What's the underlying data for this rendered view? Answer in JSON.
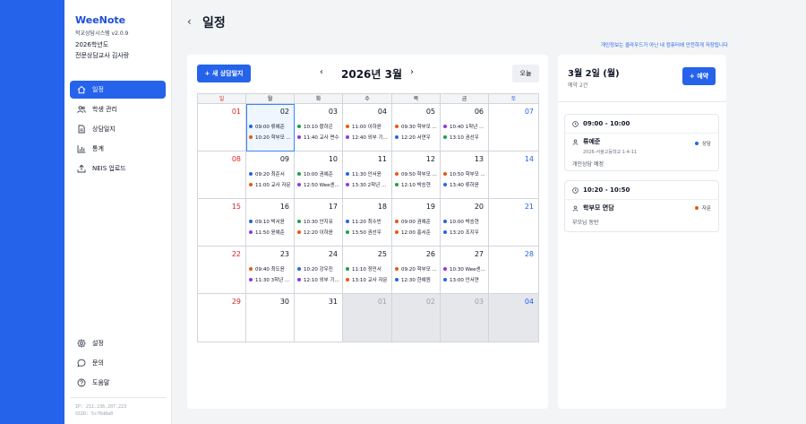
{
  "app": {
    "brand": "WeeNote",
    "version": "학교상담시스템 v2.0.9",
    "school_year": "2026학년도",
    "teacher": "전문상담교사 김사랑"
  },
  "nav": [
    {
      "label": "일정",
      "icon": "calendar-icon",
      "active": true
    },
    {
      "label": "학생 관리",
      "icon": "users-icon",
      "active": false
    },
    {
      "label": "상담일지",
      "icon": "document-icon",
      "active": false
    },
    {
      "label": "통계",
      "icon": "bar-chart-icon",
      "active": false
    },
    {
      "label": "NEIS 업로드",
      "icon": "upload-icon",
      "active": false
    }
  ],
  "nav_bottom": [
    {
      "label": "설정",
      "icon": "gear-icon"
    },
    {
      "label": "문의",
      "icon": "chat-icon"
    },
    {
      "label": "도움말",
      "icon": "help-icon"
    }
  ],
  "ip_info": [
    "IP: 211.236.207.223",
    "SSID: 5c76d8a0"
  ],
  "page": {
    "title": "일정",
    "notice": "개인정보는 클라우드가 아닌 내 컴퓨터에 안전하게 저장됩니다"
  },
  "calendar": {
    "new_button": "+ 새 상담일지",
    "month_title": "2026년 3월",
    "today_button": "오늘",
    "weekdays": [
      "일",
      "월",
      "화",
      "수",
      "목",
      "금",
      "토"
    ],
    "weeks": [
      [
        {
          "day": "01",
          "other": false,
          "events": []
        },
        {
          "day": "02",
          "other": false,
          "selected": true,
          "events": [
            {
              "text": "09:00 류예준",
              "color": "#2563eb"
            },
            {
              "text": "10:20 학부모 ...",
              "color": "#ea580c"
            }
          ]
        },
        {
          "day": "03",
          "other": false,
          "events": [
            {
              "text": "10:10 황하은",
              "color": "#16a34a"
            },
            {
              "text": "11:40 교사 면수",
              "color": "#9333ea"
            }
          ]
        },
        {
          "day": "04",
          "other": false,
          "events": [
            {
              "text": "11:00 이하윤",
              "color": "#ea580c"
            },
            {
              "text": "12:40 외부 기...",
              "color": "#9333ea"
            }
          ]
        },
        {
          "day": "05",
          "other": false,
          "events": [
            {
              "text": "09:30 학부모 ...",
              "color": "#ea580c"
            },
            {
              "text": "12:20 서연우",
              "color": "#2563eb"
            }
          ]
        },
        {
          "day": "06",
          "other": false,
          "events": [
            {
              "text": "10:40 1학년 집...",
              "color": "#9333ea"
            },
            {
              "text": "13:10 권선우",
              "color": "#16a34a"
            }
          ]
        },
        {
          "day": "07",
          "other": false,
          "events": []
        }
      ],
      [
        {
          "day": "08",
          "other": false,
          "events": []
        },
        {
          "day": "09",
          "other": false,
          "events": [
            {
              "text": "09:20 최준서",
              "color": "#2563eb"
            },
            {
              "text": "11:00 교사 자문",
              "color": "#ea580c"
            }
          ]
        },
        {
          "day": "10",
          "other": false,
          "events": [
            {
              "text": "10:00 권예준",
              "color": "#16a34a"
            },
            {
              "text": "12:50 Wee센...",
              "color": "#9333ea"
            }
          ]
        },
        {
          "day": "11",
          "other": false,
          "events": [
            {
              "text": "11:30 안서윤",
              "color": "#2563eb"
            },
            {
              "text": "13:30 2학년 ...",
              "color": "#9333ea"
            }
          ]
        },
        {
          "day": "12",
          "other": false,
          "events": [
            {
              "text": "09:50 학부모 ...",
              "color": "#ea580c"
            },
            {
              "text": "12:10 박승현",
              "color": "#16a34a"
            }
          ]
        },
        {
          "day": "13",
          "other": false,
          "events": [
            {
              "text": "10:50 학부모 ...",
              "color": "#ea580c"
            },
            {
              "text": "13:40 류하윤",
              "color": "#2563eb"
            }
          ]
        },
        {
          "day": "14",
          "other": false,
          "events": []
        }
      ],
      [
        {
          "day": "15",
          "other": false,
          "events": []
        },
        {
          "day": "16",
          "other": false,
          "events": [
            {
              "text": "09:10 박서윤",
              "color": "#2563eb"
            },
            {
              "text": "11:50 윤예준",
              "color": "#9333ea"
            }
          ]
        },
        {
          "day": "17",
          "other": false,
          "events": [
            {
              "text": "10:30 안지유",
              "color": "#16a34a"
            },
            {
              "text": "12:20 이하윤",
              "color": "#ea580c"
            }
          ]
        },
        {
          "day": "18",
          "other": false,
          "events": [
            {
              "text": "11:20 최수빈",
              "color": "#2563eb"
            },
            {
              "text": "13:50 권선우",
              "color": "#16a34a"
            }
          ]
        },
        {
          "day": "19",
          "other": false,
          "events": [
            {
              "text": "09:00 권예준",
              "color": "#ea580c"
            },
            {
              "text": "12:00 홍서준",
              "color": "#ea580c"
            }
          ]
        },
        {
          "day": "20",
          "other": false,
          "events": [
            {
              "text": "10:00 박승현",
              "color": "#2563eb"
            },
            {
              "text": "13:20 조지우",
              "color": "#2563eb"
            }
          ]
        },
        {
          "day": "21",
          "other": false,
          "events": []
        }
      ],
      [
        {
          "day": "22",
          "other": false,
          "events": []
        },
        {
          "day": "23",
          "other": false,
          "events": [
            {
              "text": "09:40 최도윤",
              "color": "#ea580c"
            },
            {
              "text": "11:30 3학년 집단",
              "color": "#9333ea"
            }
          ]
        },
        {
          "day": "24",
          "other": false,
          "events": [
            {
              "text": "10:20 강우진",
              "color": "#2563eb"
            },
            {
              "text": "12:10 외부 기...",
              "color": "#9333ea"
            }
          ]
        },
        {
          "day": "25",
          "other": false,
          "events": [
            {
              "text": "11:10 정민서",
              "color": "#16a34a"
            },
            {
              "text": "13:10 교사 자문",
              "color": "#ea580c"
            }
          ]
        },
        {
          "day": "26",
          "other": false,
          "events": [
            {
              "text": "09:20 학부모 ...",
              "color": "#ea580c"
            },
            {
              "text": "12:30 한예원",
              "color": "#2563eb"
            }
          ]
        },
        {
          "day": "27",
          "other": false,
          "events": [
            {
              "text": "10:30 Wee센...",
              "color": "#9333ea"
            },
            {
              "text": "13:00 안서연",
              "color": "#2563eb"
            }
          ]
        },
        {
          "day": "28",
          "other": false,
          "events": []
        }
      ],
      [
        {
          "day": "29",
          "other": false,
          "events": []
        },
        {
          "day": "30",
          "other": false,
          "events": []
        },
        {
          "day": "31",
          "other": false,
          "events": []
        },
        {
          "day": "01",
          "other": true,
          "events": []
        },
        {
          "day": "02",
          "other": true,
          "events": []
        },
        {
          "day": "03",
          "other": true,
          "events": []
        },
        {
          "day": "04",
          "other": true,
          "events": []
        }
      ]
    ]
  },
  "detail": {
    "date": "3월 2일 (월)",
    "count": "예약 2건",
    "add_button": "+ 예약",
    "appointments": [
      {
        "time": "09:00 - 10:00",
        "name": "류예준",
        "sub": "2026-서울고등학교 1-4-11",
        "note": "개인상담 예정",
        "type": "상담",
        "type_color": "#2563eb"
      },
      {
        "time": "10:20 - 10:50",
        "name": "학부모 면담",
        "sub": "",
        "note": "부모님 동반",
        "type": "자문",
        "type_color": "#ea580c"
      }
    ]
  }
}
